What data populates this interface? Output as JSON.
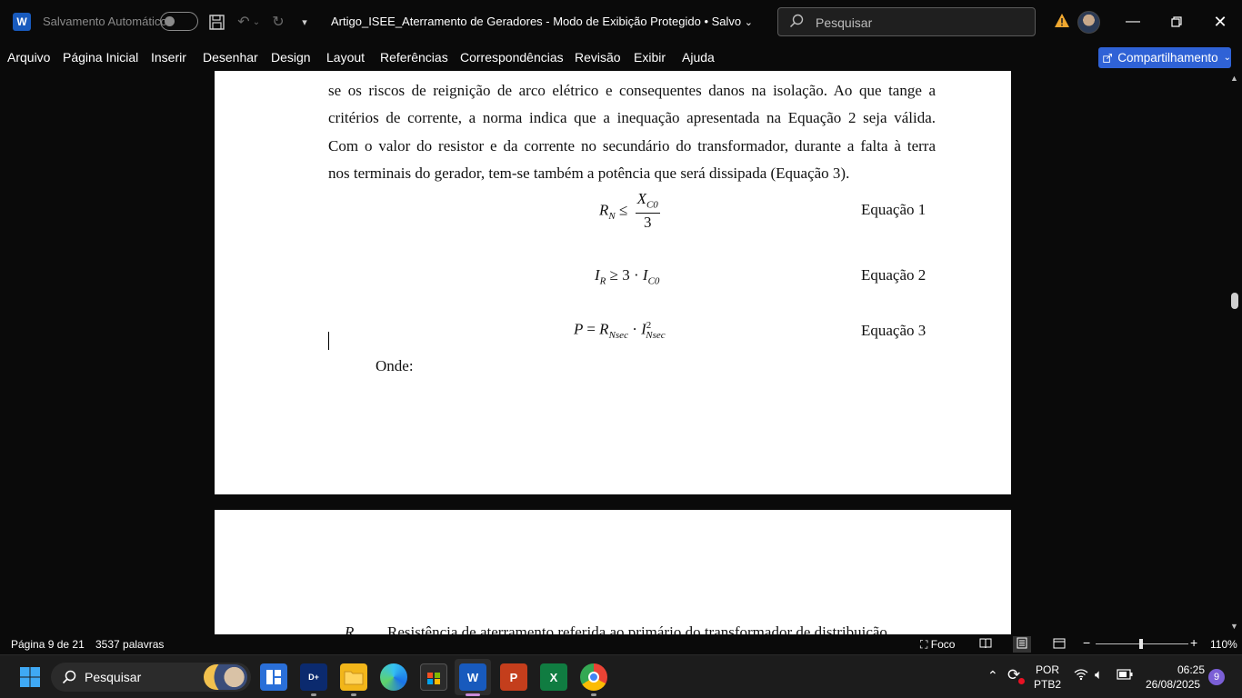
{
  "titlebar": {
    "autosave_label": "Salvamento Automático",
    "doc_title": "Artigo_ISEE_Aterramento de Geradores  -  Modo de Exibição Protegido  •  Salvo",
    "search_placeholder": "Pesquisar"
  },
  "menu": {
    "items": [
      "Arquivo",
      "Página Inicial",
      "Inserir",
      "Desenhar",
      "Design",
      "Layout",
      "Referências",
      "Correspondências",
      "Revisão",
      "Exibir",
      "Ajuda"
    ],
    "share_label": "Compartilhamento"
  },
  "document": {
    "lines": [
      "se os riscos de reignição de arco elétrico e consequentes danos na isolação. Ao que tange a",
      "critérios de corrente, a norma indica que a inequação apresentada na Equação 2 seja válida.",
      "Com o valor do resistor e da corrente no secundário do transformador, durante a falta à terra",
      "nos terminais do gerador, tem-se também a potência que será dissipada (Equação 3)."
    ],
    "equations": [
      {
        "label": "Equação 1"
      },
      {
        "label": "Equação 2"
      },
      {
        "label": "Equação 3"
      }
    ],
    "onde": "Onde:",
    "page2_line": "Resistência de aterramento referida ao primário do transformador de distribuição"
  },
  "statusbar": {
    "page": "Página 9 de 21",
    "words": "3537 palavras",
    "focus": "Foco",
    "zoom": "110%"
  },
  "taskbar": {
    "search_label": "Pesquisar",
    "lang": "POR",
    "layout": "PTB2",
    "time": "06:25",
    "date": "26/08/2025",
    "notifications": "9"
  },
  "colors": {
    "accent": "#2f62d6",
    "word_blue": "#185abd"
  }
}
